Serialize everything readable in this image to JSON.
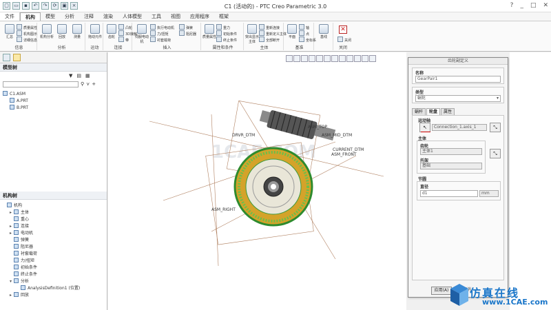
{
  "titlebar": {
    "title": "C1 (活动的) - PTC Creo Parametric 3.0",
    "controls": [
      "?",
      "_",
      "□",
      "✕"
    ]
  },
  "menu": {
    "file": "文件",
    "tabs": [
      "机构",
      "模型",
      "分析",
      "注释",
      "渲染",
      "人体模型",
      "工具",
      "视图",
      "应用程序",
      "框架"
    ]
  },
  "ribbon": {
    "groups": [
      {
        "label": "信息",
        "buttons": [
          "汇总"
        ],
        "small": [
          "质量属性",
          "机构图示",
          "详细信息"
        ]
      },
      {
        "label": "分析",
        "buttons": [
          "机构分析",
          "回放",
          "测量"
        ]
      },
      {
        "label": "运动",
        "buttons": [
          "拖动元件"
        ]
      },
      {
        "label": "连接",
        "buttons": [
          "齿轮"
        ],
        "small": [
          "凸轮",
          "3D接触",
          "带"
        ]
      },
      {
        "label": "插入",
        "buttons": [
          "伺服电动机"
        ],
        "small": [
          "执行电动机",
          "力/扭矩",
          "衬套载荷",
          "弹簧",
          "阻尼器"
        ]
      },
      {
        "label": "属性和条件",
        "buttons": [
          "质量属性"
        ],
        "small": [
          "重力",
          "初始条件",
          "终止条件"
        ]
      },
      {
        "label": "主体",
        "buttons": [
          "突出显示主体"
        ],
        "small": [
          "重新连接",
          "重新定义主体",
          "全部断开"
        ]
      },
      {
        "label": "基准",
        "buttons": [
          "平面"
        ],
        "small": [
          "轴",
          "点",
          "坐标系"
        ]
      },
      {
        "label": "基准",
        "buttons": [
          "基线"
        ]
      },
      {
        "label": "关闭",
        "buttons": [
          "关闭"
        ]
      }
    ]
  },
  "leftpanel": {
    "model_tree_title": "模型树",
    "search_placeholder": "",
    "model_tree": [
      {
        "label": "C1.ASM",
        "level": 0
      },
      {
        "label": "A.PRT",
        "level": 1
      },
      {
        "label": "B.PRT",
        "level": 1
      }
    ],
    "mech_tree_title": "机构树",
    "mech_tree": [
      {
        "label": "机构",
        "level": 0,
        "exp": ""
      },
      {
        "label": "主体",
        "level": 1,
        "exp": "▸"
      },
      {
        "label": "重心",
        "level": 1,
        "exp": ""
      },
      {
        "label": "连接",
        "level": 1,
        "exp": "▸"
      },
      {
        "label": "电动机",
        "level": 1,
        "exp": "▸"
      },
      {
        "label": "弹簧",
        "level": 1,
        "exp": ""
      },
      {
        "label": "阻尼器",
        "level": 1,
        "exp": ""
      },
      {
        "label": "衬套载荷",
        "level": 1,
        "exp": ""
      },
      {
        "label": "力/扭矩",
        "level": 1,
        "exp": ""
      },
      {
        "label": "初始条件",
        "level": 1,
        "exp": ""
      },
      {
        "label": "终止条件",
        "level": 1,
        "exp": ""
      },
      {
        "label": "分析",
        "level": 1,
        "exp": "▾"
      },
      {
        "label": "AnalysisDefinition1 (位置)",
        "level": 2,
        "exp": ""
      },
      {
        "label": "回放",
        "level": 1,
        "exp": "▸"
      }
    ]
  },
  "viewport": {
    "labels": [
      "ASM_TOP",
      "DRVR_DTM",
      "ASM_MID_DTM",
      "CURRENT_DTM",
      "ASM_FRONT",
      "ASM_RIGHT"
    ],
    "watermark": "1CAE.COM"
  },
  "dialog": {
    "title": "齿轮副定义",
    "name_label": "名称",
    "name_value": "GearPair1",
    "type_label": "类型",
    "type_value": "蜗轮",
    "tabs": [
      "蜗杆",
      "轮盘",
      "属性"
    ],
    "active_tab": "轮盘",
    "motion_axis_label": "运动轴",
    "motion_axis_value": "Connection_1.axis_1",
    "body_label": "主体",
    "gear_label": "齿轮",
    "gear_value": "主体1",
    "carrier_label": "托架",
    "carrier_value": "基础",
    "pitch_label": "节圆",
    "diameter_label": "直径",
    "diameter_value": "d1",
    "unit": "mm",
    "apply": "应用(A)",
    "cancel": "取消"
  },
  "logo": {
    "name_cn": "仿真在线",
    "site": "www.1CAE.com"
  }
}
